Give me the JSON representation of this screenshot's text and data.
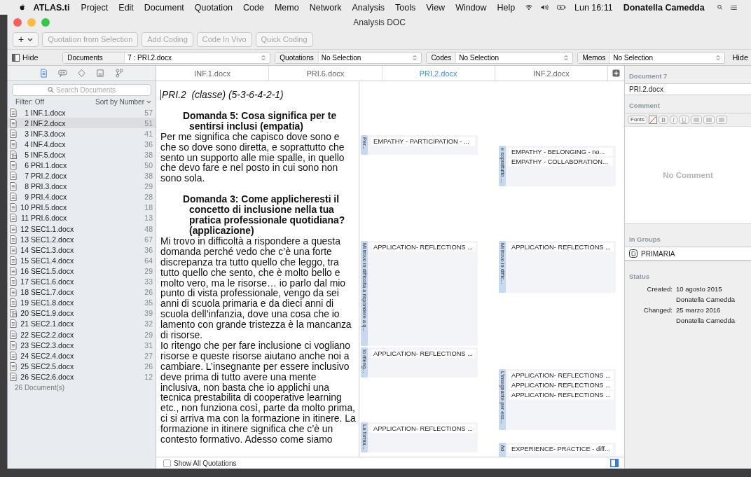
{
  "menubar": {
    "app": "ATLAS.ti",
    "items": [
      "Project",
      "Edit",
      "Document",
      "Quotation",
      "Code",
      "Memo",
      "Network",
      "Analysis",
      "Tools",
      "View",
      "Window",
      "Help"
    ],
    "clock": "Lun 16:11",
    "user": "Donatella Camedda"
  },
  "window": {
    "title": "Analysis DOC"
  },
  "toolbar": {
    "add_label": "+",
    "buttons": [
      {
        "label": "Quotation from Selection",
        "disabled": true
      },
      {
        "label": "Add Coding",
        "disabled": true
      },
      {
        "label": "Code In Vivo",
        "disabled": true
      },
      {
        "label": "Quick Coding",
        "disabled": true
      }
    ]
  },
  "selectors": {
    "hide": "Hide",
    "fields": [
      {
        "label": "Documents",
        "value": "7 : PRI.2.docx"
      },
      {
        "label": "Quotations",
        "value": "No Selection"
      },
      {
        "label": "Codes",
        "value": "No Selection"
      },
      {
        "label": "Memos",
        "value": "No Selection"
      }
    ],
    "hide_right": "Hide"
  },
  "sidebar": {
    "tabs": [
      {
        "kind": "document",
        "selected": true
      },
      {
        "kind": "quotation",
        "selected": false
      },
      {
        "kind": "code",
        "selected": false
      },
      {
        "kind": "memo",
        "selected": false
      },
      {
        "kind": "network",
        "selected": false
      }
    ],
    "search": {
      "placeholder": "Search Documents"
    },
    "filter": "Filter: Off",
    "sort": "Sort by Number",
    "documents": [
      {
        "number": "1",
        "name": "INF.1.docx",
        "count": "57",
        "kind": "text",
        "selected": false
      },
      {
        "number": "2",
        "name": "INF.2.docx",
        "count": "51",
        "kind": "text",
        "selected": true
      },
      {
        "number": "3",
        "name": "INF.3.docx",
        "count": "41",
        "kind": "text",
        "selected": false
      },
      {
        "number": "4",
        "name": "INF.4.docx",
        "count": "36",
        "kind": "text",
        "selected": false
      },
      {
        "number": "5",
        "name": "INF.5.docx",
        "count": "38",
        "kind": "multi",
        "selected": false
      },
      {
        "number": "6",
        "name": "PRI.1.docx",
        "count": "50",
        "kind": "text",
        "selected": false
      },
      {
        "number": "7",
        "name": "PRI.2.docx",
        "count": "38",
        "kind": "text",
        "selected": false
      },
      {
        "number": "8",
        "name": "PRI.3.docx",
        "count": "29",
        "kind": "text",
        "selected": false
      },
      {
        "number": "9",
        "name": "PRI.4.docx",
        "count": "28",
        "kind": "text",
        "selected": false
      },
      {
        "number": "10",
        "name": "PRI.5.docx",
        "count": "18",
        "kind": "text",
        "selected": false
      },
      {
        "number": "11",
        "name": "PRI.6.docx",
        "count": "13",
        "kind": "text",
        "selected": false
      },
      {
        "number": "12",
        "name": "SEC1.1.docx",
        "count": "48",
        "kind": "text",
        "selected": false
      },
      {
        "number": "13",
        "name": "SEC1.2.docx",
        "count": "67",
        "kind": "text",
        "selected": false
      },
      {
        "number": "14",
        "name": "SEC1.3.docx",
        "count": "36",
        "kind": "text",
        "selected": false
      },
      {
        "number": "15",
        "name": "SEC1.4.docx",
        "count": "64",
        "kind": "text",
        "selected": false
      },
      {
        "number": "16",
        "name": "SEC1.5.docx",
        "count": "29",
        "kind": "text",
        "selected": false
      },
      {
        "number": "17",
        "name": "SEC1.6.docx",
        "count": "33",
        "kind": "text",
        "selected": false
      },
      {
        "number": "18",
        "name": "SEC1.7.docx",
        "count": "26",
        "kind": "text",
        "selected": false
      },
      {
        "number": "19",
        "name": "SEC1.8.docx",
        "count": "35",
        "kind": "text",
        "selected": false
      },
      {
        "number": "20",
        "name": "SEC1.9.docx",
        "count": "39",
        "kind": "multi",
        "selected": false
      },
      {
        "number": "21",
        "name": "SEC2.1.docx",
        "count": "32",
        "kind": "text",
        "selected": false
      },
      {
        "number": "22",
        "name": "SEC2.2.docx",
        "count": "29",
        "kind": "text",
        "selected": false
      },
      {
        "number": "23",
        "name": "SEC2.3.docx",
        "count": "31",
        "kind": "text",
        "selected": false
      },
      {
        "number": "24",
        "name": "SEC2.4.docx",
        "count": "27",
        "kind": "text",
        "selected": false
      },
      {
        "number": "25",
        "name": "SEC2.5.docx",
        "count": "26",
        "kind": "text",
        "selected": false
      },
      {
        "number": "26",
        "name": "SEC2.6.docx",
        "count": "12",
        "kind": "text",
        "selected": false
      }
    ],
    "footer": "26 Document(s)"
  },
  "editor": {
    "tabs": [
      {
        "label": "INF.1.docx",
        "selected": false
      },
      {
        "label": "PRI.6.docx",
        "selected": false
      },
      {
        "label": "PRI.2.docx",
        "selected": true
      },
      {
        "label": "INF.2.docx",
        "selected": false
      }
    ],
    "blocks": [
      {
        "kind": "title",
        "text": "PRI.2  (classe) (5-3-6-4-2-1)"
      },
      {
        "kind": "heading",
        "text": "Domanda 5: Cosa significa per te sentirsi inclusi (empatia)"
      },
      {
        "kind": "paragraph",
        "text": "Per me significa che capisco dove sono e che so dove sono diretta, e soprattutto che sento un supporto alle mie spalle, in quello che devo fare e nel posto in cui sono non sono sola."
      },
      {
        "kind": "heading",
        "text": "Domanda 3: Come applicheresti il concetto di inclusione nella tua pratica professionale quotidiana? (applicazione)"
      },
      {
        "kind": "paragraph",
        "text": "Mi trovo in difficoltà a rispondere a questa domanda perché vedo che c’è una forte discrepanza tra tutto quello che leggo, tra tutto quello che sento, che è molto bello e molto vero, ma le risorse… io parlo dal mio punto di vista professionale, vengo da sei anni di scuola primaria e da dieci anni di scuola dell’infanzia, dove una cosa che io lamento con grande tristezza è la mancanza di risorse."
      },
      {
        "kind": "paragraph",
        "text": "Io ritengo che per fare inclusione ci vogliano risorse e queste risorse aiutano anche noi a cambiare. L’insegnante per essere inclusivo deve prima di tutto avere una mente inclusiva, non basta che io applichi una tecnica prestabilita di cooperative learning etc., non funziona così, parte da molto prima, ci si arriva ma con la formazione in itinere. La formazione in itinere significa che c’è un contesto formativo. Adesso come siamo"
      }
    ],
    "show_all": {
      "label": "Show All Quotations",
      "checked": false
    }
  },
  "margin": {
    "columns": [
      [
        {
          "excerpt": "Per...",
          "codes": [
            "EMPATHY - PARTICIPATION - ..."
          ]
        },
        {
          "excerpt": "Mi trovo in difficoltà a rispondere a q...",
          "codes": [
            "APPLICATION- REFLECTIONS ..."
          ]
        },
        {
          "excerpt": "Io riteng...",
          "codes": [
            "APPLICATION- REFLECTIONS ..."
          ]
        },
        {
          "excerpt": "La forma...",
          "codes": [
            "APPLICATION- REFLECTIONS ..."
          ]
        }
      ],
      [
        {
          "excerpt": "e soprattutto ...",
          "codes": [
            "EMPATHY - BELONGING - no...",
            "EMPATHY - COLLABORATION..."
          ]
        },
        {
          "excerpt": "Mi trovo in diffic...",
          "codes": [
            "APPLICATION- REFLECTIONS ..."
          ]
        },
        {
          "excerpt": "L’insegnante per ess...",
          "codes": [
            "APPLICATION- REFLECTIONS ...",
            "APPLICATION- REFLECTIONS ...",
            "APPLICATION- REFLECTIONS ..."
          ]
        },
        {
          "excerpt": "Ad",
          "codes": [
            "EXPERIENCE- PRACTICE - diff..."
          ]
        }
      ]
    ]
  },
  "inspector": {
    "heading": "Document 7",
    "name": "PRI.2.docx",
    "comment_label": "Comment",
    "fonts": "Fonts",
    "format_buttons": [
      "B",
      "I",
      "U"
    ],
    "comment_placeholder": "No Comment",
    "groups_label": "In Groups",
    "groups": [
      "PRIMARIA"
    ],
    "status_label": "Status",
    "status": [
      {
        "label": "Created:",
        "date": "10 agosto 2015",
        "user": "Donatella Camedda"
      },
      {
        "label": "Changed:",
        "date": "25 marzo 2016",
        "user": "Donatella Camedda"
      }
    ]
  }
}
